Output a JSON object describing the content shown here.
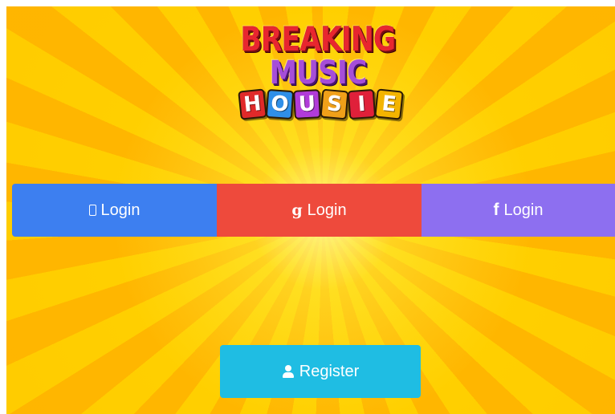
{
  "logo": {
    "line1": "BREAKING",
    "line2": "MUSIC",
    "tiles": [
      {
        "letter": "H",
        "color": "#e02a2a"
      },
      {
        "letter": "O",
        "color": "#2f8fe8"
      },
      {
        "letter": "U",
        "color": "#b13bd9"
      },
      {
        "letter": "S",
        "color": "#f0a019"
      },
      {
        "letter": "I",
        "color": "#e0203a"
      },
      {
        "letter": "E",
        "color": "#f3b400"
      }
    ]
  },
  "login": {
    "mobile_label": "Login",
    "mobile_icon": "mobile-phone-icon",
    "google_label": "Login",
    "google_icon_glyph": "g",
    "facebook_label": "Login",
    "facebook_icon_glyph": "f",
    "colors": {
      "mobile": "#3d7ff0",
      "google": "#ee4a3c",
      "facebook": "#8d6ff0"
    }
  },
  "register": {
    "label": "Register",
    "icon": "user-icon",
    "color": "#1fbde3"
  },
  "background": {
    "style": "yellow sunburst",
    "colors": [
      "#ffd400",
      "#ffb800"
    ]
  }
}
